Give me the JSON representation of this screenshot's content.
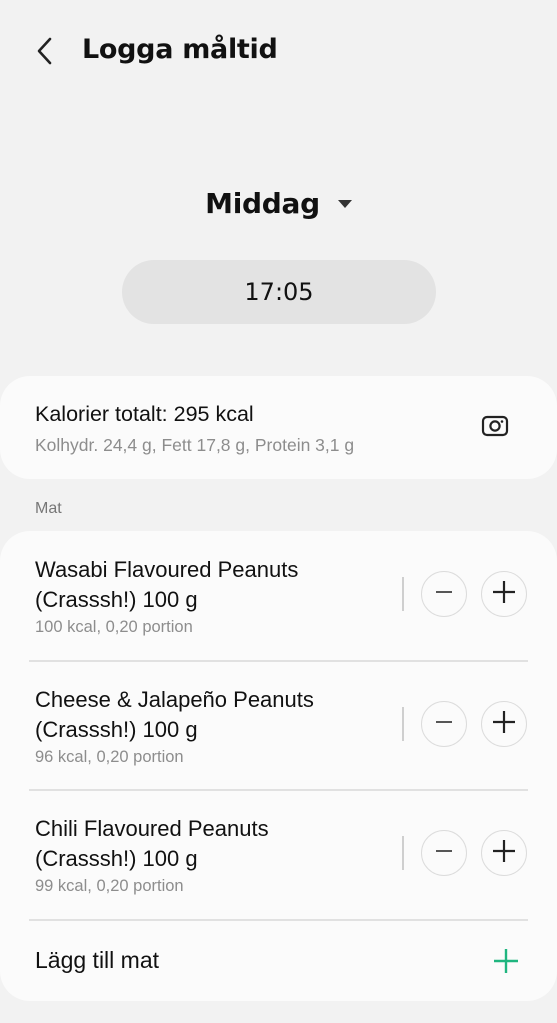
{
  "header": {
    "title": "Logga måltid",
    "back_icon": "chevron-left-icon"
  },
  "meal": {
    "selected": "Middag",
    "dropdown_icon": "caret-down-icon"
  },
  "time": "17:05",
  "summary": {
    "total": "Kalorier totalt: 295 kcal",
    "macros": "Kolhydr. 24,4 g, Fett 17,8 g, Protein 3,1 g",
    "camera_icon": "camera-icon"
  },
  "section_label": "Mat",
  "foods": [
    {
      "name": "Wasabi Flavoured Peanuts (Crasssh!) 100 g",
      "detail": "100 kcal, 0,20 portion"
    },
    {
      "name": "Cheese & Jalapeño Peanuts (Crasssh!) 100 g",
      "detail": "96 kcal, 0,20 portion"
    },
    {
      "name": "Chili Flavoured Peanuts (Crasssh!) 100 g",
      "detail": "99 kcal, 0,20 portion"
    }
  ],
  "add_food": {
    "label": "Lägg till mat",
    "icon": "plus-icon",
    "accent_color": "#1fb57f"
  },
  "colors": {
    "background": "#f2f2f2",
    "card": "#fbfbfb",
    "time_pill": "#e3e3e3",
    "secondary_text": "#8d8d8d"
  }
}
